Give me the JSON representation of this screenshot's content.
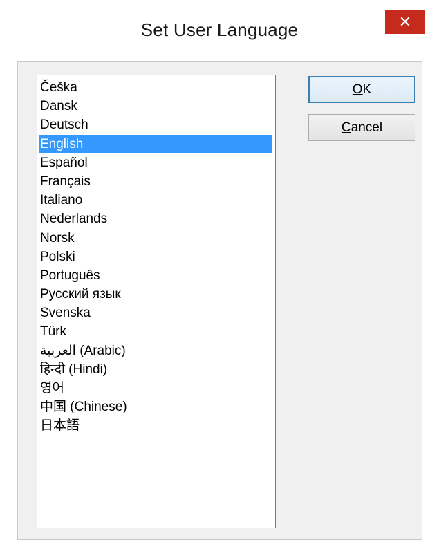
{
  "window": {
    "title": "Set User Language",
    "close_glyph": "✕"
  },
  "languages": [
    "Češka",
    "Dansk",
    "Deutsch",
    "English",
    "Español",
    "Français",
    "Italiano",
    "Nederlands",
    "Norsk",
    "Polski",
    "Português",
    "Русский язык",
    "Svenska",
    "Türk",
    "العربية (Arabic)",
    "हिन्दी (Hindi)",
    "영어",
    "中国 (Chinese)",
    "日本語"
  ],
  "selected_language": "English",
  "buttons": {
    "ok": {
      "mnemonic": "O",
      "rest": "K"
    },
    "cancel": {
      "mnemonic": "C",
      "rest": "ancel"
    }
  },
  "colors": {
    "selection": "#3399ff",
    "close": "#c42b1c",
    "default_button_border": "#3c7fb1"
  }
}
